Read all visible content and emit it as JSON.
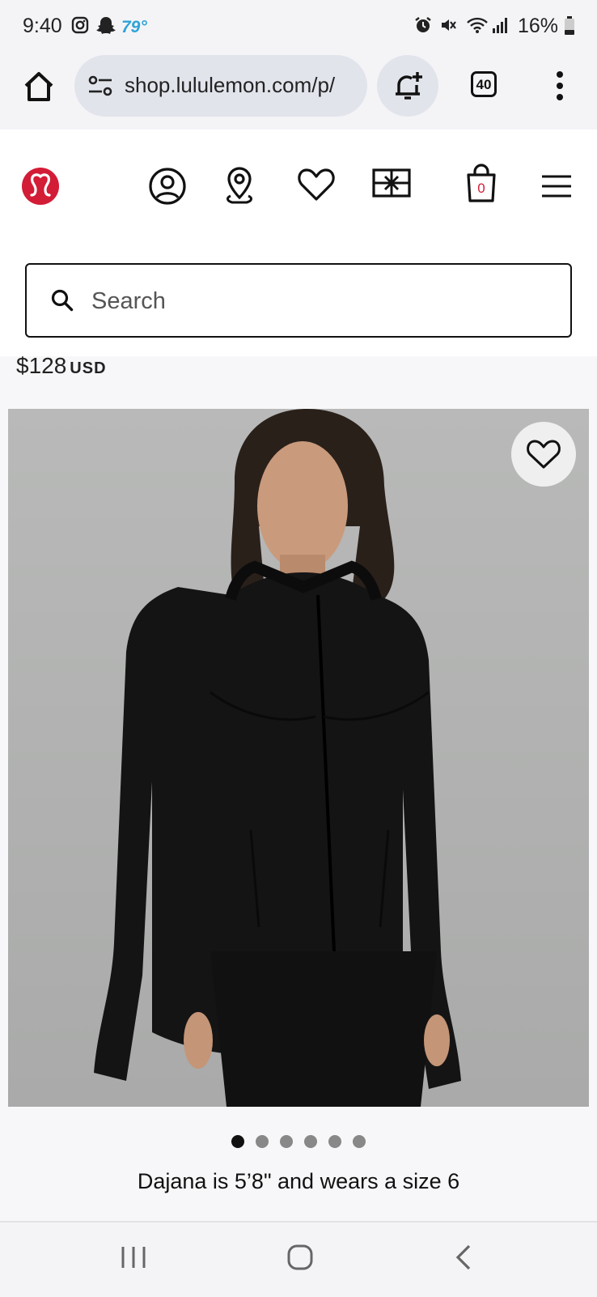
{
  "status_bar": {
    "time": "9:40",
    "temperature": "79°",
    "battery": "16%",
    "icons": [
      "instagram-icon",
      "snapchat-icon",
      "alarm-icon",
      "mute-icon",
      "wifi-icon",
      "signal-icon",
      "battery-icon"
    ]
  },
  "browser": {
    "url": "shop.lululemon.com/p/",
    "tab_count": "40",
    "icons": [
      "home-icon",
      "site-settings-icon",
      "add-alert-icon",
      "tabs-icon",
      "overflow-menu-icon"
    ]
  },
  "site_header": {
    "icons": [
      "lululemon-logo",
      "account-icon",
      "store-locator-icon",
      "wishlist-icon",
      "gift-card-icon",
      "bag-icon",
      "hamburger-menu-icon"
    ],
    "bag_count": "0",
    "brand_color": "#d31c36"
  },
  "search": {
    "placeholder": "Search"
  },
  "product": {
    "price": "$128",
    "currency": "USD",
    "image_count": 6,
    "active_image": 1,
    "model_caption": "Dajana is 5’8\" and wears a size 6"
  },
  "nav_bar": {
    "icons": [
      "recent-apps-icon",
      "home-nav-icon",
      "back-icon"
    ]
  }
}
